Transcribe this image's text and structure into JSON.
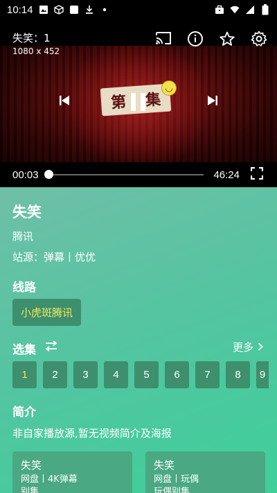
{
  "status_bar": {
    "time": "10:14"
  },
  "player": {
    "episode_title": "失笑：1",
    "resolution": "1080 x 452",
    "video_caption_left": "第",
    "video_caption_right": "集",
    "current_time": "00:03",
    "duration": "46:24",
    "progress_fraction": 0.001
  },
  "show": {
    "title": "失笑",
    "platform": "腾讯",
    "source_label": "站源：弹幕丨优优"
  },
  "lines": {
    "section_title": "线路",
    "items": [
      "小虎斑腾讯"
    ]
  },
  "episodes": {
    "section_title": "选集",
    "more_label": "更多",
    "items": [
      "1",
      "2",
      "3",
      "4",
      "5",
      "6",
      "7",
      "8",
      "9"
    ],
    "active": "1"
  },
  "intro": {
    "section_title": "简介",
    "text": "非自家播放源,暂无视频简介及海报"
  },
  "related": [
    {
      "title": "失笑",
      "sub": "网盘丨4K弹幕",
      "third": "别集"
    },
    {
      "title": "失笑",
      "sub": "网盘丨玩偶",
      "third": "玩偶别集"
    }
  ],
  "colors": {
    "accent_yellow": "#f5e85a",
    "chip_bg": "#3d8f6e",
    "content_bg_start": "#6fbfa7",
    "content_bg_end": "#3ecf9b"
  },
  "icons": {
    "status": [
      "image-icon",
      "cube-icon",
      "square-icon",
      "download-icon",
      "dot-icon",
      "briefcase-icon",
      "wifi-icon",
      "signal-icon",
      "battery-icon"
    ],
    "player": [
      "cast-icon",
      "info-icon",
      "star-icon",
      "settings-icon",
      "skip-previous-icon",
      "pause-icon",
      "skip-next-icon",
      "fullscreen-icon"
    ]
  }
}
